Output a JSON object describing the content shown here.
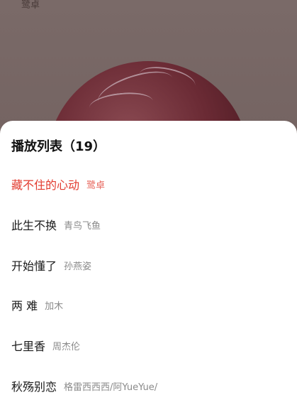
{
  "player": {
    "artist": "鹭卓"
  },
  "playlist": {
    "title": "播放列表（19）",
    "songs": [
      {
        "name": "藏不住的心动",
        "artist": "鹭卓",
        "active": true
      },
      {
        "name": "此生不换",
        "artist": "青鸟飞鱼",
        "active": false
      },
      {
        "name": "开始懂了",
        "artist": "孙燕姿",
        "active": false
      },
      {
        "name": "两 难",
        "artist": "加木",
        "active": false
      },
      {
        "name": "七里香",
        "artist": "周杰伦",
        "active": false
      },
      {
        "name": "秋殇别恋",
        "artist": "格雷西西西/阿YueYue/",
        "active": false
      }
    ]
  },
  "colors": {
    "active": "#e23a2e",
    "sheet": "#ffffff",
    "overlay": "#6b5a58"
  }
}
